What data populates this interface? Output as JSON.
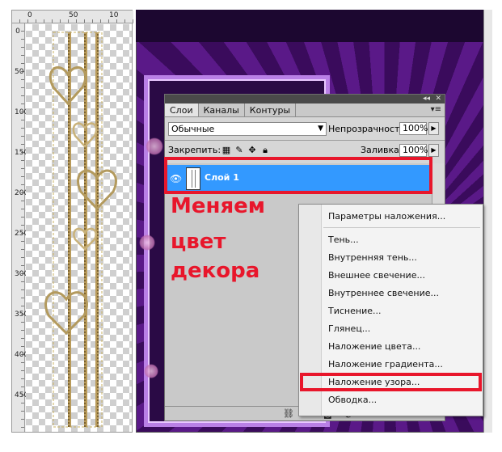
{
  "rulers": {
    "top_numbers": [
      "0",
      "50",
      "10"
    ],
    "left_numbers": [
      "0",
      "50",
      "100",
      "150",
      "200",
      "250",
      "300",
      "350",
      "400",
      "450"
    ]
  },
  "panel": {
    "tabs": [
      {
        "label": "Слои",
        "active": true
      },
      {
        "label": "Каналы",
        "active": false
      },
      {
        "label": "Контуры",
        "active": false
      }
    ],
    "blend_mode": "Обычные",
    "opacity_label": "Непрозрачность:",
    "opacity_value": "100%",
    "lock_label": "Закрепить:",
    "fill_label": "Заливка:",
    "fill_value": "100%",
    "layer_name": "Слой 1"
  },
  "annotation": {
    "lines": [
      "Меняем",
      "цвет",
      "декора"
    ],
    "color": "#e8162b"
  },
  "context_menu": {
    "items": [
      {
        "label": "Параметры наложения...",
        "highlighted": false
      },
      {
        "label": "Тень...",
        "highlighted": false
      },
      {
        "label": "Внутренняя тень...",
        "highlighted": false
      },
      {
        "label": "Внешнее свечение...",
        "highlighted": false
      },
      {
        "label": "Внутреннее свечение...",
        "highlighted": false
      },
      {
        "label": "Тиснение...",
        "highlighted": false
      },
      {
        "label": "Глянец...",
        "highlighted": false
      },
      {
        "label": "Наложение цвета...",
        "highlighted": false
      },
      {
        "label": "Наложение градиента...",
        "highlighted": false
      },
      {
        "label": "Наложение узора...",
        "highlighted": true
      },
      {
        "label": "Обводка...",
        "highlighted": false
      }
    ]
  },
  "colors": {
    "layer_selected": "#3399ff",
    "canvas_purple": "#5a1988",
    "frame_lilac": "#b980e6"
  }
}
